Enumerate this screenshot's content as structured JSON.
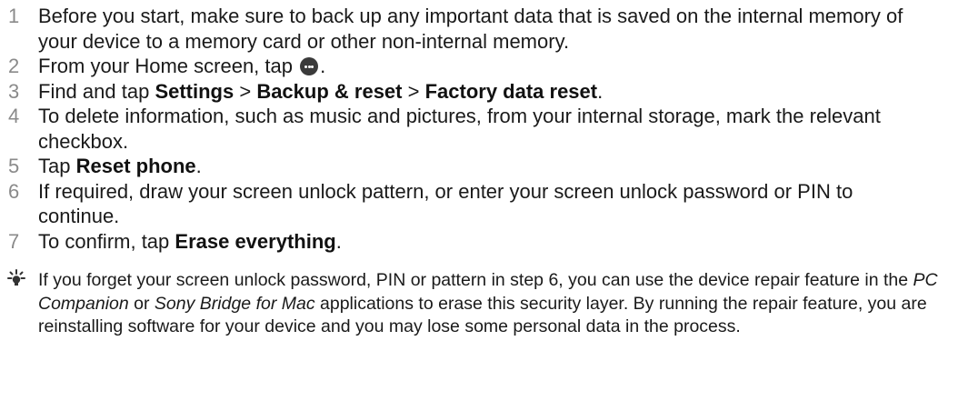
{
  "steps": [
    {
      "num": "1",
      "parts": [
        {
          "text": "Before you start, make sure to back up any important data that is saved on the internal memory of your device to a memory card or other non-internal memory."
        }
      ]
    },
    {
      "num": "2",
      "parts": [
        {
          "text": "From your Home screen, tap "
        },
        {
          "icon": "apps-icon"
        },
        {
          "text": "."
        }
      ]
    },
    {
      "num": "3",
      "parts": [
        {
          "text": "Find and tap "
        },
        {
          "bold": "Settings"
        },
        {
          "text": " > "
        },
        {
          "bold": "Backup & reset"
        },
        {
          "text": " > "
        },
        {
          "bold": "Factory data reset"
        },
        {
          "text": "."
        }
      ]
    },
    {
      "num": "4",
      "parts": [
        {
          "text": "To delete information, such as music and pictures, from your internal storage, mark the relevant checkbox."
        }
      ]
    },
    {
      "num": "5",
      "parts": [
        {
          "text": "Tap "
        },
        {
          "bold": "Reset phone"
        },
        {
          "text": "."
        }
      ]
    },
    {
      "num": "6",
      "parts": [
        {
          "text": "If required, draw your screen unlock pattern, or enter your screen unlock password or PIN to continue."
        }
      ]
    },
    {
      "num": "7",
      "parts": [
        {
          "text": "To confirm, tap "
        },
        {
          "bold": "Erase everything"
        },
        {
          "text": "."
        }
      ]
    }
  ],
  "tip": {
    "icon": "lightbulb-icon",
    "parts": [
      {
        "text": "If you forget your screen unlock password, PIN or pattern in step 6, you can use the device repair feature in the "
      },
      {
        "italic": "PC Companion"
      },
      {
        "text": " or "
      },
      {
        "italic": "Sony Bridge for Mac"
      },
      {
        "text": " applications to erase this security layer. By running the repair feature, you are reinstalling software for your device and you may lose some personal data in the process."
      }
    ]
  }
}
